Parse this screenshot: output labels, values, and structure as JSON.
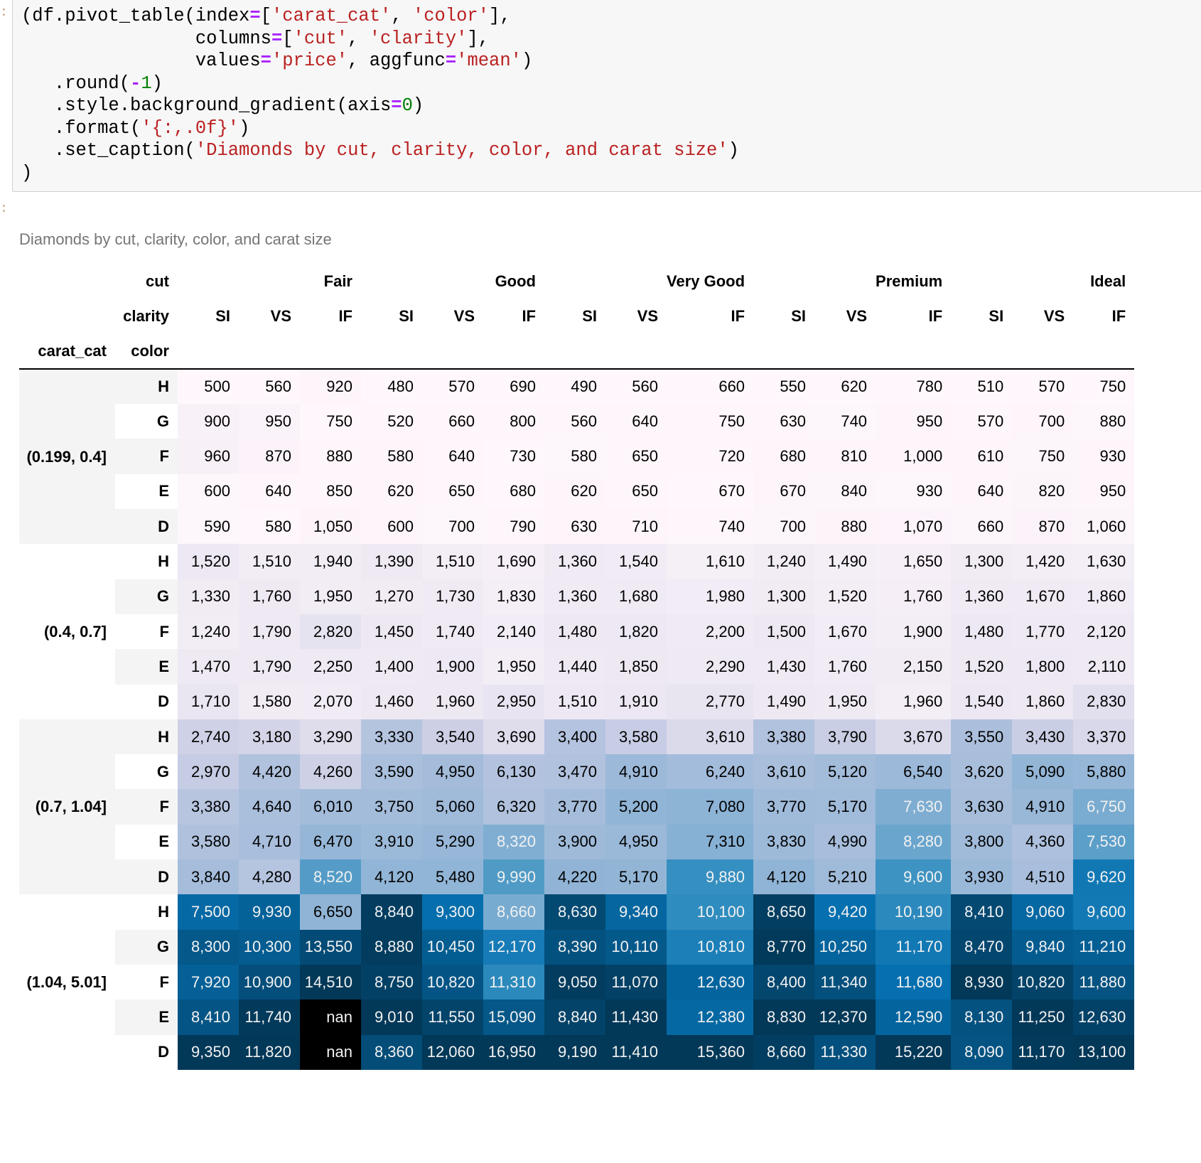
{
  "code_cell": {
    "lines": [
      [
        {
          "t": "(df.pivot_table(index"
        },
        {
          "t": "=",
          "c": "op"
        },
        {
          "t": "["
        },
        {
          "t": "'carat_cat'",
          "c": "str"
        },
        {
          "t": ", "
        },
        {
          "t": "'color'",
          "c": "str"
        },
        {
          "t": "],"
        }
      ],
      [
        {
          "t": "                columns"
        },
        {
          "t": "=",
          "c": "op"
        },
        {
          "t": "["
        },
        {
          "t": "'cut'",
          "c": "str"
        },
        {
          "t": ", "
        },
        {
          "t": "'clarity'",
          "c": "str"
        },
        {
          "t": "],"
        }
      ],
      [
        {
          "t": "                values"
        },
        {
          "t": "=",
          "c": "op"
        },
        {
          "t": "'price'",
          "c": "str"
        },
        {
          "t": ", aggfunc"
        },
        {
          "t": "=",
          "c": "op"
        },
        {
          "t": "'mean'",
          "c": "str"
        },
        {
          "t": ")"
        }
      ],
      [
        {
          "t": "   .round("
        },
        {
          "t": "-",
          "c": "op"
        },
        {
          "t": "1",
          "c": "num"
        },
        {
          "t": ")"
        }
      ],
      [
        {
          "t": "   .style.background_gradient(axis"
        },
        {
          "t": "=",
          "c": "op"
        },
        {
          "t": "0",
          "c": "num"
        },
        {
          "t": ")"
        }
      ],
      [
        {
          "t": "   .format("
        },
        {
          "t": "'{:,.0f}'",
          "c": "str"
        },
        {
          "t": ")"
        }
      ],
      [
        {
          "t": "   .set_caption("
        },
        {
          "t": "'Diamonds by cut, clarity, color, and carat size'",
          "c": "str"
        },
        {
          "t": ")"
        }
      ],
      [
        {
          "t": ")"
        }
      ]
    ]
  },
  "output": {
    "caption": "Diamonds by cut, clarity, color, and carat size",
    "header": {
      "cut_label": "cut",
      "clarity_label": "clarity",
      "index_names": [
        "carat_cat",
        "color"
      ],
      "cuts": [
        "Fair",
        "Good",
        "Very Good",
        "Premium",
        "Ideal"
      ],
      "clarities": [
        "SI",
        "VS",
        "IF"
      ]
    },
    "colormap": "PuBu",
    "nan_color": "#000000",
    "nan_text": "nan"
  },
  "chart_data": {
    "type": "table",
    "title": "Diamonds by cut, clarity, color, and carat size",
    "column_levels": {
      "cut": [
        "Fair",
        "Good",
        "Very Good",
        "Premium",
        "Ideal"
      ],
      "clarity": [
        "SI",
        "VS",
        "IF"
      ]
    },
    "columns": [
      [
        "Fair",
        "SI"
      ],
      [
        "Fair",
        "VS"
      ],
      [
        "Fair",
        "IF"
      ],
      [
        "Good",
        "SI"
      ],
      [
        "Good",
        "VS"
      ],
      [
        "Good",
        "IF"
      ],
      [
        "Very Good",
        "SI"
      ],
      [
        "Very Good",
        "VS"
      ],
      [
        "Very Good",
        "IF"
      ],
      [
        "Premium",
        "SI"
      ],
      [
        "Premium",
        "VS"
      ],
      [
        "Premium",
        "IF"
      ],
      [
        "Ideal",
        "SI"
      ],
      [
        "Ideal",
        "VS"
      ],
      [
        "Ideal",
        "IF"
      ]
    ],
    "row_groups": [
      {
        "carat_cat": "(0.199, 0.4]",
        "rows": [
          {
            "color": "H",
            "values": [
              500,
              560,
              920,
              480,
              570,
              690,
              490,
              560,
              660,
              550,
              620,
              780,
              510,
              570,
              750
            ]
          },
          {
            "color": "G",
            "values": [
              900,
              950,
              750,
              520,
              660,
              800,
              560,
              640,
              750,
              630,
              740,
              950,
              570,
              700,
              880
            ]
          },
          {
            "color": "F",
            "values": [
              960,
              870,
              880,
              580,
              640,
              730,
              580,
              650,
              720,
              680,
              810,
              1000,
              610,
              750,
              930
            ]
          },
          {
            "color": "E",
            "values": [
              600,
              640,
              850,
              620,
              650,
              680,
              620,
              650,
              670,
              670,
              840,
              930,
              640,
              820,
              950
            ]
          },
          {
            "color": "D",
            "values": [
              590,
              580,
              1050,
              600,
              700,
              790,
              630,
              710,
              740,
              700,
              880,
              1070,
              660,
              870,
              1060
            ]
          }
        ]
      },
      {
        "carat_cat": "(0.4, 0.7]",
        "rows": [
          {
            "color": "H",
            "values": [
              1520,
              1510,
              1940,
              1390,
              1510,
              1690,
              1360,
              1540,
              1610,
              1240,
              1490,
              1650,
              1300,
              1420,
              1630
            ]
          },
          {
            "color": "G",
            "values": [
              1330,
              1760,
              1950,
              1270,
              1730,
              1830,
              1360,
              1680,
              1980,
              1300,
              1520,
              1760,
              1360,
              1670,
              1860
            ]
          },
          {
            "color": "F",
            "values": [
              1240,
              1790,
              2820,
              1450,
              1740,
              2140,
              1480,
              1820,
              2200,
              1500,
              1670,
              1900,
              1480,
              1770,
              2120
            ]
          },
          {
            "color": "E",
            "values": [
              1470,
              1790,
              2250,
              1400,
              1900,
              1950,
              1440,
              1850,
              2290,
              1430,
              1760,
              2150,
              1520,
              1800,
              2110
            ]
          },
          {
            "color": "D",
            "values": [
              1710,
              1580,
              2070,
              1460,
              1960,
              2950,
              1510,
              1910,
              2770,
              1490,
              1950,
              1960,
              1540,
              1860,
              2830
            ]
          }
        ]
      },
      {
        "carat_cat": "(0.7, 1.04]",
        "rows": [
          {
            "color": "H",
            "values": [
              2740,
              3180,
              3290,
              3330,
              3540,
              3690,
              3400,
              3580,
              3610,
              3380,
              3790,
              3670,
              3550,
              3430,
              3370
            ]
          },
          {
            "color": "G",
            "values": [
              2970,
              4420,
              4260,
              3590,
              4950,
              6130,
              3470,
              4910,
              6240,
              3610,
              5120,
              6540,
              3620,
              5090,
              5880
            ]
          },
          {
            "color": "F",
            "values": [
              3380,
              4640,
              6010,
              3750,
              5060,
              6320,
              3770,
              5200,
              7080,
              3770,
              5170,
              7630,
              3630,
              4910,
              6750
            ]
          },
          {
            "color": "E",
            "values": [
              3580,
              4710,
              6470,
              3910,
              5290,
              8320,
              3900,
              4950,
              7310,
              3830,
              4990,
              8280,
              3800,
              4360,
              7530
            ]
          },
          {
            "color": "D",
            "values": [
              3840,
              4280,
              8520,
              4120,
              5480,
              9990,
              4220,
              5170,
              9880,
              4120,
              5210,
              9600,
              3930,
              4510,
              9620
            ]
          }
        ]
      },
      {
        "carat_cat": "(1.04, 5.01]",
        "rows": [
          {
            "color": "H",
            "values": [
              7500,
              9930,
              6650,
              8840,
              9300,
              8660,
              8630,
              9340,
              10100,
              8650,
              9420,
              10190,
              8410,
              9060,
              9600
            ]
          },
          {
            "color": "G",
            "values": [
              8300,
              10300,
              13550,
              8880,
              10450,
              12170,
              8390,
              10110,
              10810,
              8770,
              10250,
              11170,
              8470,
              9840,
              11210
            ]
          },
          {
            "color": "F",
            "values": [
              7920,
              10900,
              14510,
              8750,
              10820,
              11310,
              9050,
              11070,
              12630,
              8400,
              11340,
              11680,
              8930,
              10820,
              11880
            ]
          },
          {
            "color": "E",
            "values": [
              8410,
              11740,
              null,
              9010,
              11550,
              15090,
              8840,
              11430,
              12380,
              8830,
              12370,
              12590,
              8130,
              11250,
              12630
            ]
          },
          {
            "color": "D",
            "values": [
              9350,
              11820,
              null,
              8360,
              12060,
              16950,
              9190,
              11410,
              15360,
              8660,
              11330,
              15220,
              8090,
              11170,
              13100
            ]
          }
        ]
      }
    ]
  }
}
